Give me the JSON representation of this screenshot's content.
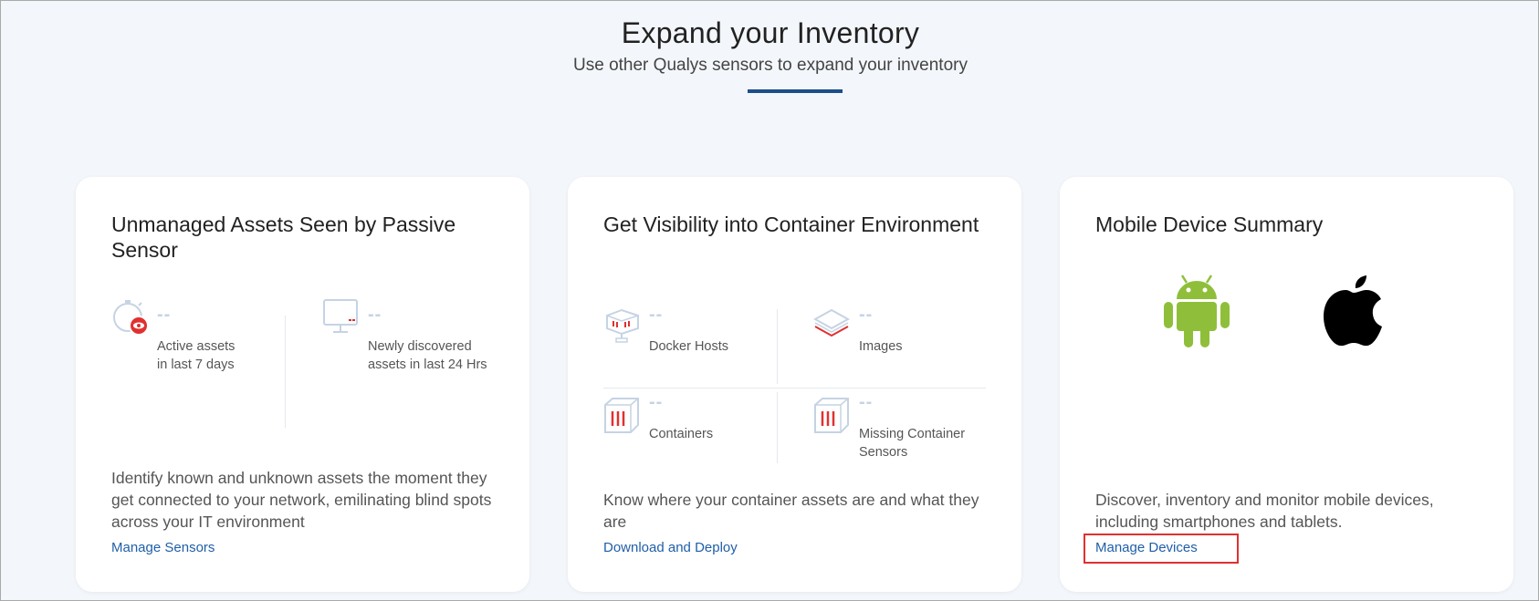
{
  "header": {
    "title": "Expand your Inventory",
    "subtitle": "Use other Qualys sensors to expand your inventory"
  },
  "cards": [
    {
      "title": "Unmanaged Assets Seen by Passive Sensor",
      "metrics": [
        {
          "value": "--",
          "label_line1": "Active assets",
          "label_line2": "in last 7 days",
          "icon": "passive-sensor-stopwatch-icon"
        },
        {
          "value": "--",
          "label_line1": "Newly discovered",
          "label_line2": "assets in last 24 Hrs",
          "icon": "monitor-icon"
        }
      ],
      "description": "Identify known and unknown assets the moment they get connected to your network, emilinating blind spots across your IT environment",
      "link": "Manage Sensors"
    },
    {
      "title": "Get Visibility into Container Environment",
      "metrics": [
        {
          "value": "--",
          "label_line1": "Docker Hosts",
          "label_line2": "",
          "icon": "docker-host-icon"
        },
        {
          "value": "--",
          "label_line1": "Images",
          "label_line2": "",
          "icon": "image-layers-icon"
        },
        {
          "value": "--",
          "label_line1": "Containers",
          "label_line2": "",
          "icon": "container-box-icon"
        },
        {
          "value": "--",
          "label_line1": "Missing Container",
          "label_line2": "Sensors",
          "icon": "container-box-icon"
        }
      ],
      "description": "Know where your container assets are and what they are",
      "link": "Download and Deploy"
    },
    {
      "title": "Mobile Device Summary",
      "platforms": [
        "android-icon",
        "apple-icon"
      ],
      "description": "Discover, inventory and monitor mobile devices, including smartphones and tablets.",
      "link": "Manage Devices"
    }
  ],
  "colors": {
    "accent": "#1b4f8a",
    "link": "#1f5fa8",
    "highlight": "#e03030",
    "android": "#8fbf3a"
  }
}
